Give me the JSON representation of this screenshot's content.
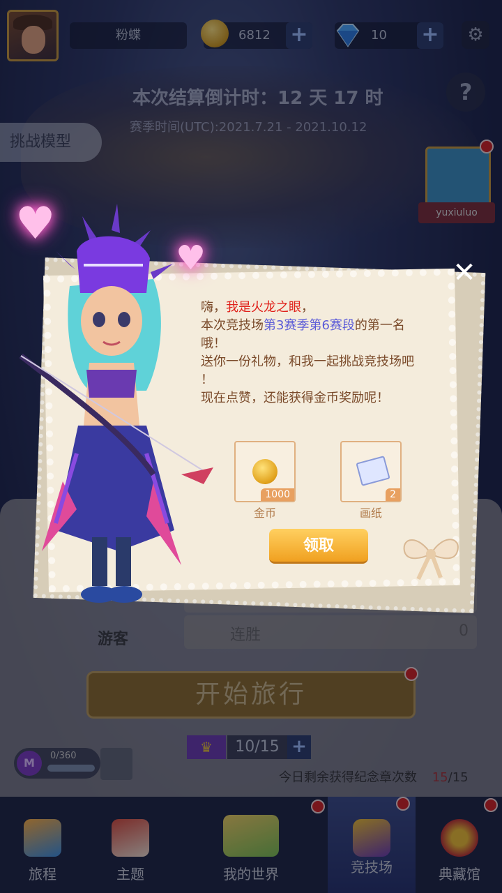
{
  "header": {
    "player_name": "粉蝶",
    "coins": "6812",
    "gems": "10"
  },
  "arena": {
    "countdown": "本次结算倒计时：12 天 17 时",
    "season_time": "赛季时间(UTC):2021.7.21 - 2021.10.12",
    "challenge_label": "挑战模型",
    "opponent_name": "yuxiuluo"
  },
  "popup": {
    "line1_a": "嗨，",
    "line1_b": "我是火龙之眼",
    "line1_c": "，",
    "line2_a": "本次竞技场",
    "line2_b": "第3赛季第6赛段",
    "line2_c": "的第一名",
    "line3": "哦！",
    "line4": "送你一份礼物，和我一起挑战竞技场吧",
    "line5": "！",
    "line6": "现在点赞，还能获得金币奖励呢！",
    "rewards": [
      {
        "label": "金币",
        "count": "1000",
        "icon": "gold-coin-icon"
      },
      {
        "label": "画纸",
        "count": "2",
        "icon": "drawing-paper-icon"
      }
    ],
    "claim_label": "领取"
  },
  "panel": {
    "guest_label": "游客",
    "win_streak_label": "连胜",
    "zero_a": "0",
    "zero_b": "0",
    "start_label": "开始旅行",
    "ticket_value": "10/15",
    "medal_progress_text": "0/360",
    "medal_letter": "M",
    "remaining_label": "今日剩余获得纪念章次数",
    "remaining_value": "15",
    "remaining_total": "/15"
  },
  "nav": {
    "tabs": [
      {
        "label": "旅程"
      },
      {
        "label": "主题"
      },
      {
        "label": "我的世界"
      },
      {
        "label": "竞技场"
      },
      {
        "label": "典藏馆"
      }
    ]
  },
  "colors": {
    "accent_gold": "#f0a020",
    "highlight_red": "#e0201a",
    "highlight_blue": "#5a5ad8",
    "nav_bg": "#1c2340"
  }
}
